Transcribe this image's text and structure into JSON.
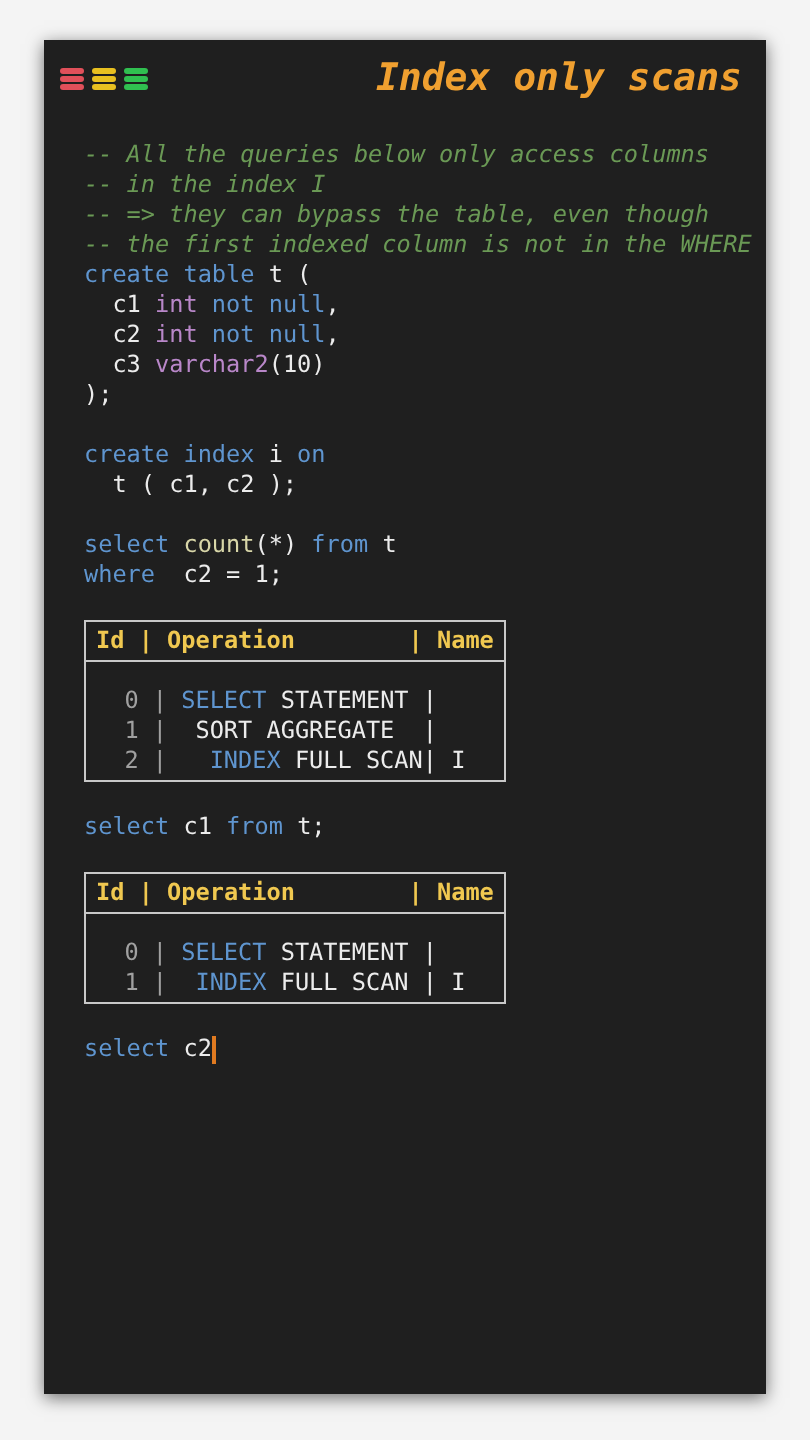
{
  "window": {
    "title": "Index only scans"
  },
  "blocks": [
    {
      "kind": "code",
      "lines": [
        [
          {
            "text": "-- All the queries below only access columns",
            "kind": "comment"
          }
        ],
        [
          {
            "text": "-- in the index I",
            "kind": "comment"
          }
        ],
        [
          {
            "text": "-- => they can bypass the table, even though",
            "kind": "comment"
          }
        ],
        [
          {
            "text": "-- the first indexed column is not in the WHERE",
            "kind": "comment"
          }
        ],
        [
          {
            "text": "create table",
            "kind": "keyword"
          },
          {
            "text": " t (",
            "kind": "plain"
          }
        ],
        [
          {
            "text": "  c1 ",
            "kind": "plain"
          },
          {
            "text": "int",
            "kind": "type"
          },
          {
            "text": " not null",
            "kind": "keyword"
          },
          {
            "text": ",",
            "kind": "plain"
          }
        ],
        [
          {
            "text": "  c2 ",
            "kind": "plain"
          },
          {
            "text": "int",
            "kind": "type"
          },
          {
            "text": " not null",
            "kind": "keyword"
          },
          {
            "text": ",",
            "kind": "plain"
          }
        ],
        [
          {
            "text": "  c3 ",
            "kind": "plain"
          },
          {
            "text": "varchar2",
            "kind": "type"
          },
          {
            "text": "(10)",
            "kind": "plain"
          }
        ],
        [
          {
            "text": ");",
            "kind": "plain"
          }
        ]
      ]
    },
    {
      "kind": "code",
      "lines": [
        [
          {
            "text": "create index",
            "kind": "keyword"
          },
          {
            "text": " i ",
            "kind": "plain"
          },
          {
            "text": "on",
            "kind": "keyword"
          }
        ],
        [
          {
            "text": "  t ( c1, c2 );",
            "kind": "plain"
          }
        ]
      ]
    },
    {
      "kind": "code",
      "lines": [
        [
          {
            "text": "select",
            "kind": "keyword"
          },
          {
            "text": " count",
            "kind": "function"
          },
          {
            "text": "(*) ",
            "kind": "plain"
          },
          {
            "text": "from",
            "kind": "keyword"
          },
          {
            "text": " t",
            "kind": "plain"
          }
        ],
        [
          {
            "text": "where",
            "kind": "keyword"
          },
          {
            "text": "  c2 = 1;",
            "kind": "plain"
          }
        ]
      ]
    },
    {
      "kind": "plan",
      "header": [
        {
          "text": "Id",
          "kind": "header"
        },
        {
          "text": " | ",
          "kind": "header"
        },
        {
          "text": "Operation",
          "kind": "header"
        },
        {
          "text": "        | ",
          "kind": "header"
        },
        {
          "text": "Name",
          "kind": "header"
        }
      ],
      "rows": [
        [
          {
            "text": "  0 | ",
            "kind": "number"
          },
          {
            "text": "SELECT",
            "kind": "keyword"
          },
          {
            "text": " STATEMENT |",
            "kind": "plain"
          }
        ],
        [
          {
            "text": "  1 | ",
            "kind": "number"
          },
          {
            "text": " SORT AGGREGATE  |",
            "kind": "plain"
          }
        ],
        [
          {
            "text": "  2 | ",
            "kind": "number"
          },
          {
            "text": "  INDEX",
            "kind": "keyword"
          },
          {
            "text": " FULL SCAN| I",
            "kind": "plain"
          }
        ]
      ]
    },
    {
      "kind": "code",
      "lines": [
        [
          {
            "text": "select",
            "kind": "keyword"
          },
          {
            "text": " c1 ",
            "kind": "plain"
          },
          {
            "text": "from",
            "kind": "keyword"
          },
          {
            "text": " t;",
            "kind": "plain"
          }
        ]
      ]
    },
    {
      "kind": "plan",
      "header": [
        {
          "text": "Id",
          "kind": "header"
        },
        {
          "text": " | ",
          "kind": "header"
        },
        {
          "text": "Operation",
          "kind": "header"
        },
        {
          "text": "        | ",
          "kind": "header"
        },
        {
          "text": "Name",
          "kind": "header"
        }
      ],
      "rows": [
        [
          {
            "text": "  0 | ",
            "kind": "number"
          },
          {
            "text": "SELECT",
            "kind": "keyword"
          },
          {
            "text": " STATEMENT |",
            "kind": "plain"
          }
        ],
        [
          {
            "text": "  1 | ",
            "kind": "number"
          },
          {
            "text": " INDEX",
            "kind": "keyword"
          },
          {
            "text": " FULL SCAN | I",
            "kind": "plain"
          }
        ]
      ]
    },
    {
      "kind": "code",
      "cursor": true,
      "lines": [
        [
          {
            "text": "select",
            "kind": "keyword"
          },
          {
            "text": " c2",
            "kind": "plain"
          }
        ]
      ]
    }
  ]
}
